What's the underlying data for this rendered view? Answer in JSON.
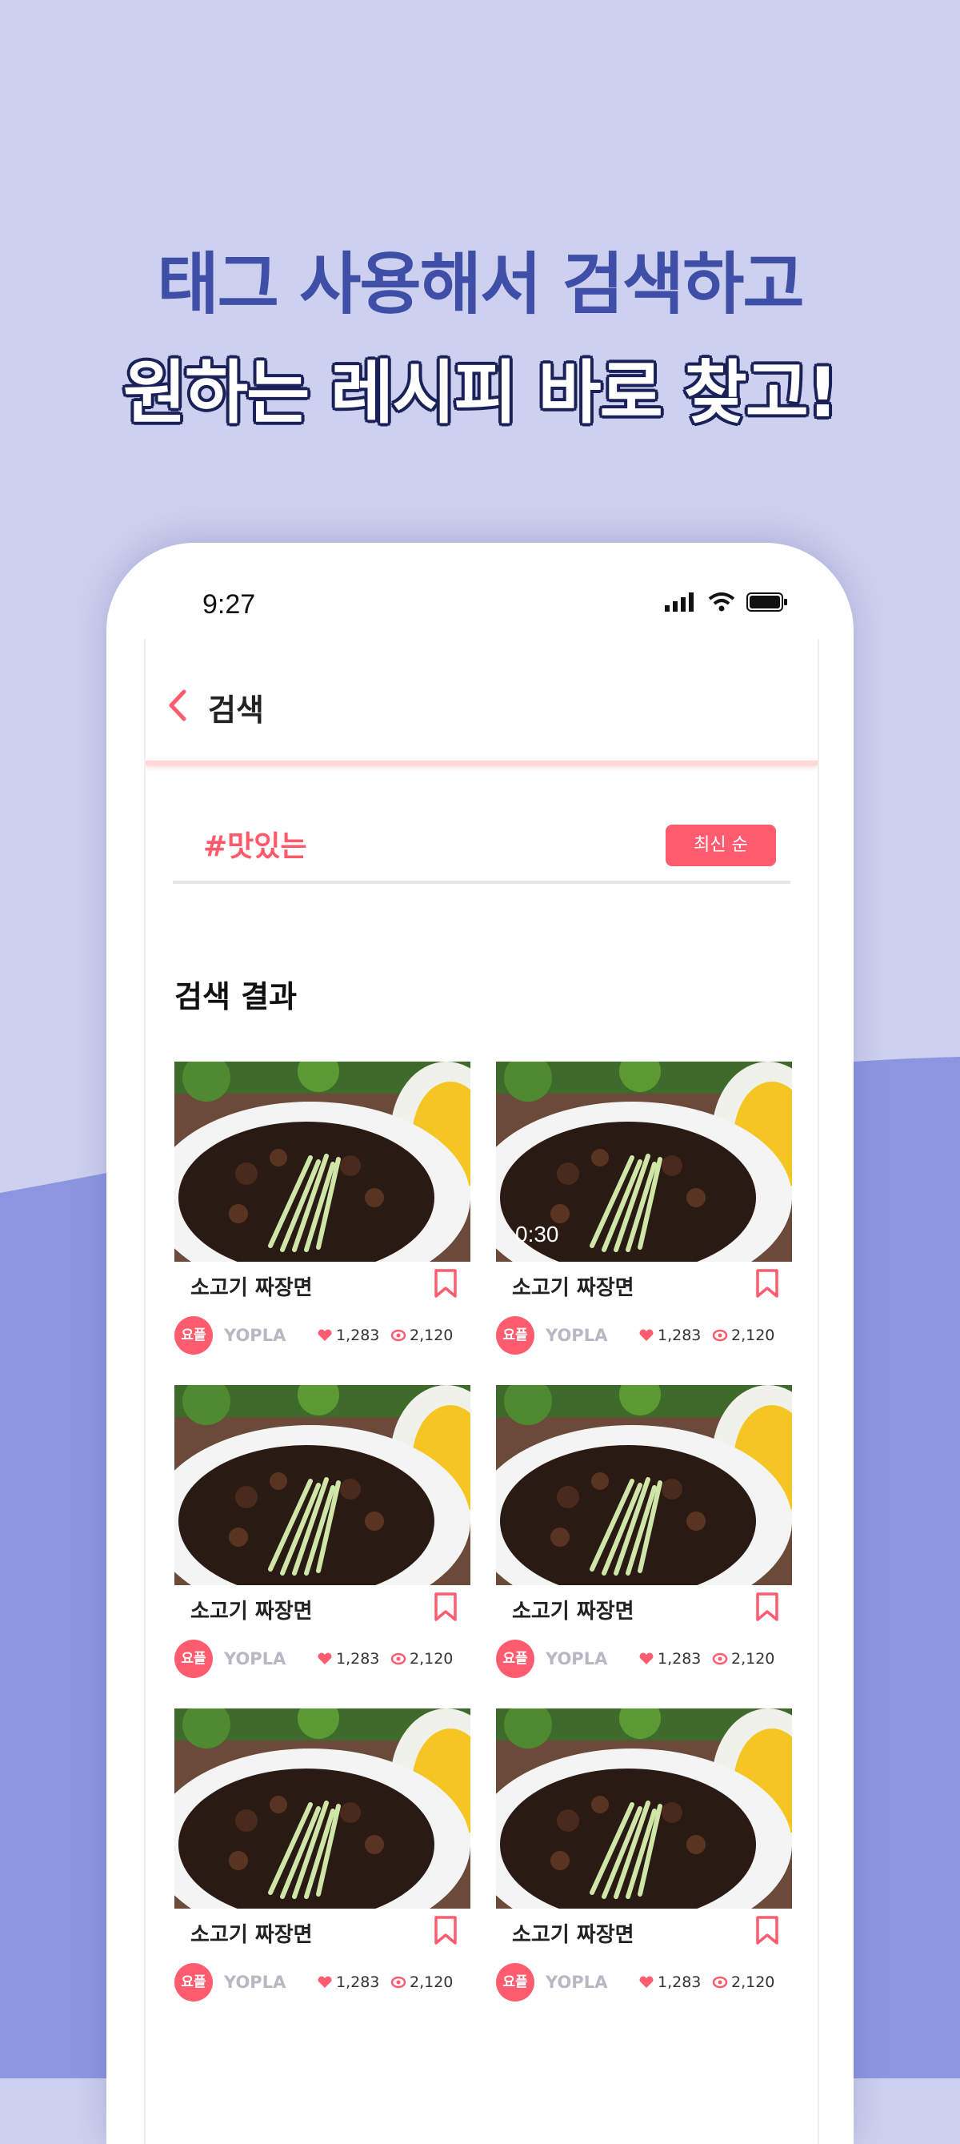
{
  "headline": {
    "line1": "태그 사용해서 검색하고",
    "line2": "원하는 레시피 바로 찾고!"
  },
  "status_bar": {
    "time": "9:27",
    "icons": [
      "signal-icon",
      "wifi-icon",
      "battery-icon"
    ]
  },
  "header": {
    "title": "검색",
    "back_icon": "chevron-left-icon"
  },
  "search": {
    "tag": "#맛있는",
    "sort_label": "최신 순"
  },
  "results": {
    "title": "검색 결과",
    "items": [
      {
        "title": "소고기 짜장면",
        "author": "YOPLA",
        "avatar": "요플",
        "likes": "1,283",
        "views": "2,120",
        "duration": ""
      },
      {
        "title": "소고기 짜장면",
        "author": "YOPLA",
        "avatar": "요플",
        "likes": "1,283",
        "views": "2,120",
        "duration": "0:30"
      },
      {
        "title": "소고기 짜장면",
        "author": "YOPLA",
        "avatar": "요플",
        "likes": "1,283",
        "views": "2,120",
        "duration": ""
      },
      {
        "title": "소고기 짜장면",
        "author": "YOPLA",
        "avatar": "요플",
        "likes": "1,283",
        "views": "2,120",
        "duration": ""
      },
      {
        "title": "소고기 짜장면",
        "author": "YOPLA",
        "avatar": "요플",
        "likes": "1,283",
        "views": "2,120",
        "duration": ""
      },
      {
        "title": "소고기 짜장면",
        "author": "YOPLA",
        "avatar": "요플",
        "likes": "1,283",
        "views": "2,120",
        "duration": ""
      }
    ]
  },
  "colors": {
    "accent": "#ff5d6f",
    "background_top": "#cdd0ee",
    "background_wave": "#8c96e0",
    "headline_blue": "#3f4fa8"
  }
}
